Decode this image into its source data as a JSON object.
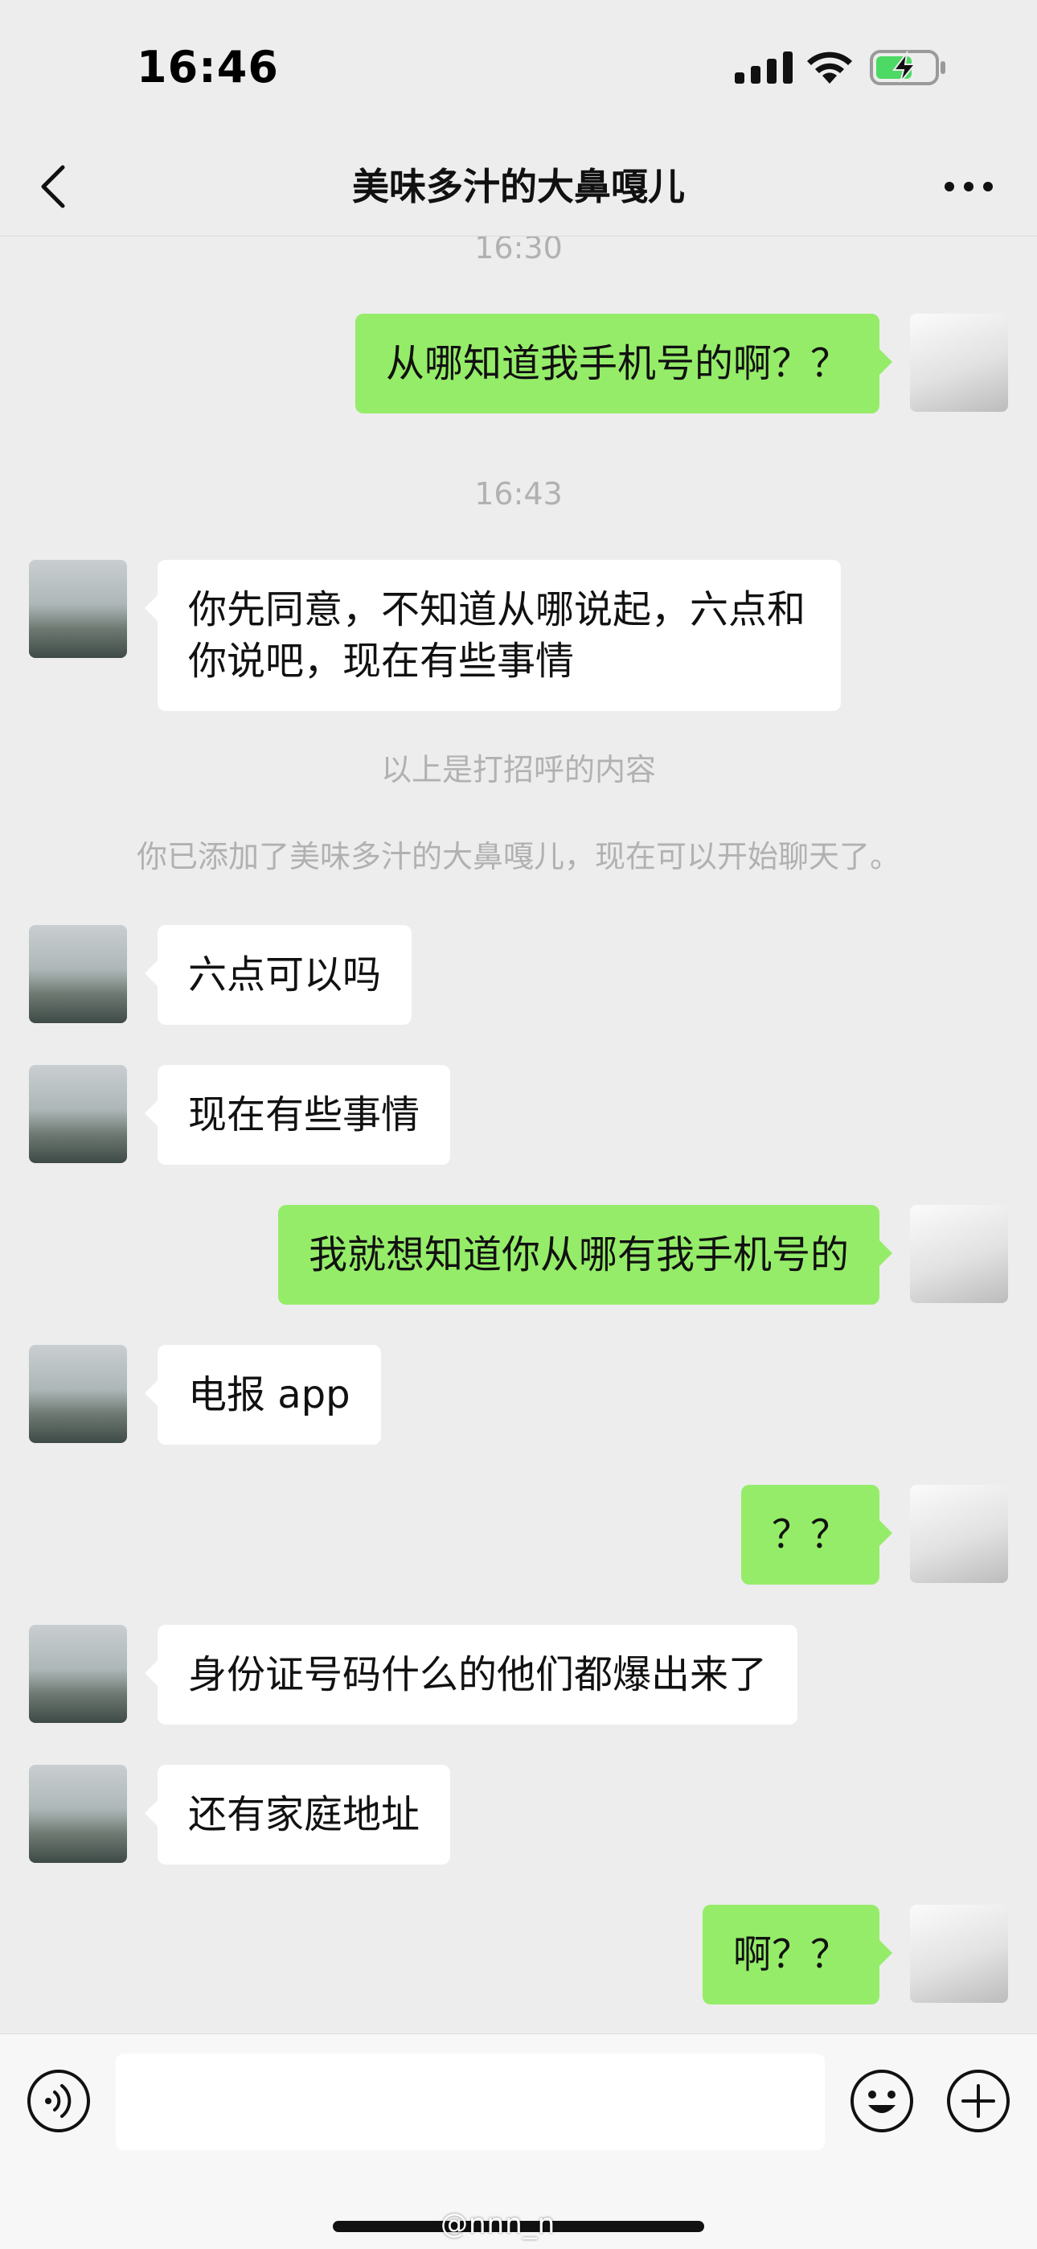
{
  "status_bar": {
    "time": "16:46",
    "icons": [
      "signal-icon",
      "wifi-icon",
      "battery-charging-icon"
    ]
  },
  "nav": {
    "title": "美味多汁的大鼻嘎儿",
    "icons": [
      "back-icon",
      "more-icon"
    ]
  },
  "messages": {
    "time_1": "16:30",
    "m1": "从哪知道我手机号的啊？？",
    "time_2": "16:43",
    "m2": "你先同意，不知道从哪说起，六点和你说吧，现在有些事情",
    "notice_1": "以上是打招呼的内容",
    "notice_2": "你已添加了美味多汁的大鼻嘎儿，现在可以开始聊天了。",
    "m3": "六点可以吗",
    "m4": "现在有些事情",
    "m5": "我就想知道你从哪有我手机号的",
    "m6": "电报 app",
    "m7": "？？",
    "m8": "身份证号码什么的他们都爆出来了",
    "m9": "还有家庭地址",
    "m10": "啊？？"
  },
  "input_bar": {
    "input_value": "",
    "icons": [
      "voice-icon",
      "emoji-icon",
      "plus-icon"
    ]
  },
  "watermark": "@nnn_n",
  "colors": {
    "background": "#ededed",
    "sent_bubble": "#95ec69",
    "received_bubble": "#ffffff",
    "meta_text": "#b1b1b1",
    "battery_charge": "#4cd964"
  }
}
